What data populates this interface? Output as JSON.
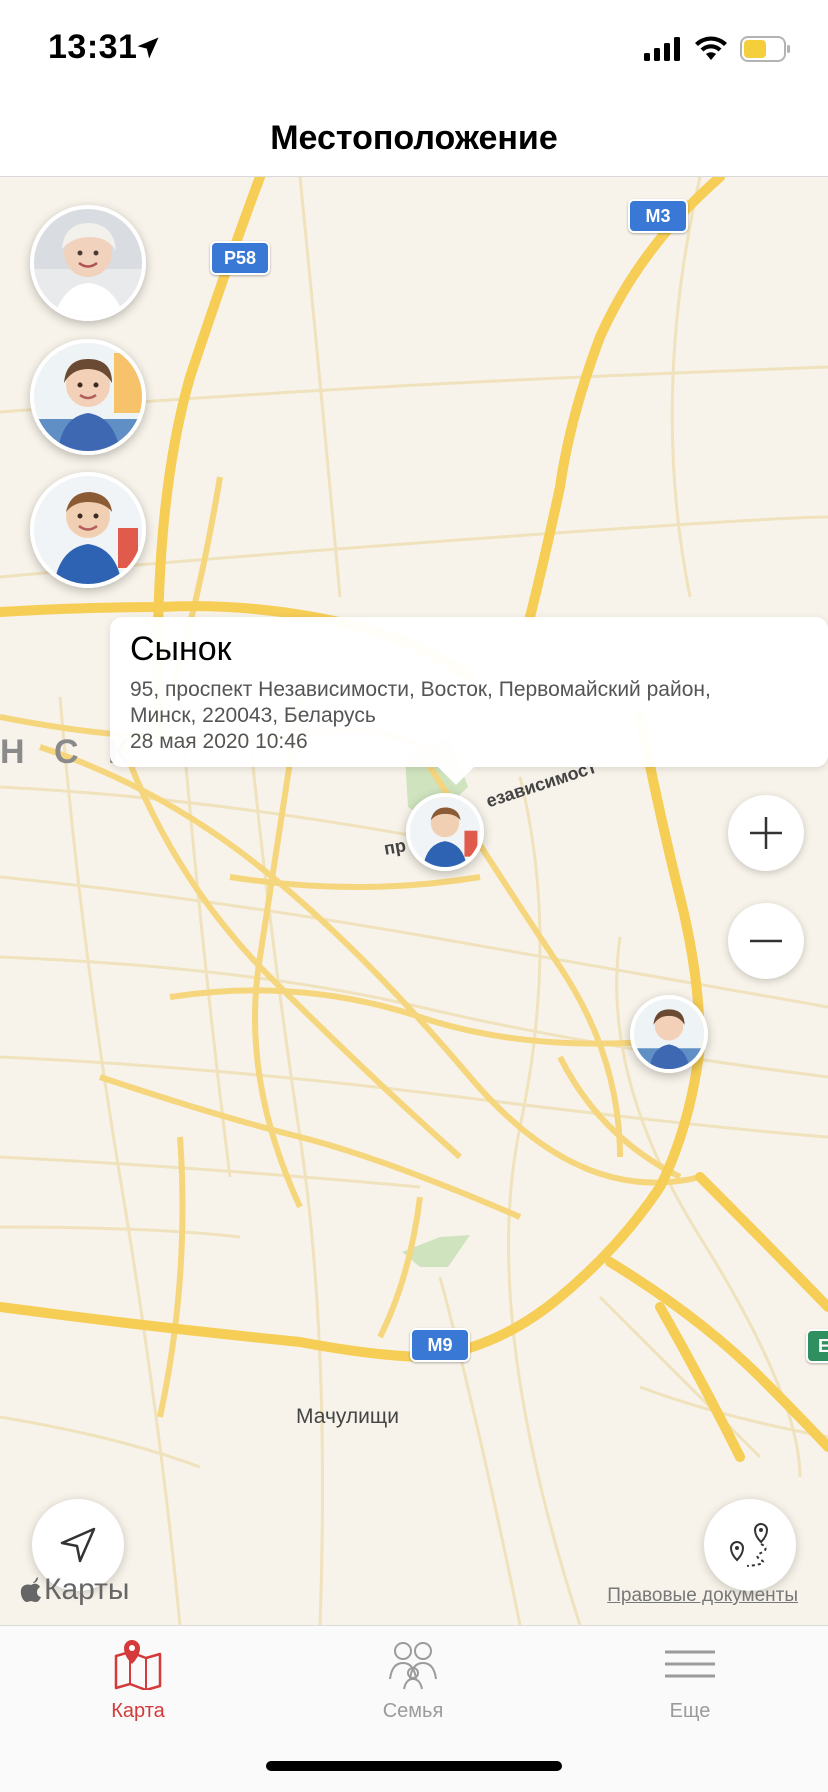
{
  "status_bar": {
    "time": "13:31",
    "icons": [
      "location-arrow-icon",
      "signal-icon",
      "wifi-icon",
      "battery-icon"
    ],
    "battery_color": "#f4cf3b"
  },
  "header": {
    "title": "Местоположение"
  },
  "map": {
    "city_label": "Н С К",
    "district_label": "Мачулищи",
    "street_labels": [
      "езависимост",
      "пр"
    ],
    "road_shields": [
      "P58",
      "M3",
      "M9",
      "E"
    ],
    "callout": {
      "title": "Сынок",
      "address_line1": "95, проспект Независимости, Восток, Первомайский район,",
      "address_line2": "Минск, 220043, Беларусь",
      "timestamp": "28 мая 2020 10:46"
    },
    "zoom_in_label": "+",
    "zoom_out_label": "−",
    "maps_attribution": "Карты",
    "legal_link": "Правовые документы",
    "avatars": [
      "grandmother-avatar",
      "daughter-avatar",
      "son-avatar"
    ],
    "markers": [
      "son-marker",
      "daughter-marker"
    ]
  },
  "tab_bar": {
    "tabs": [
      {
        "label": "Карта",
        "icon": "map-icon",
        "active": true
      },
      {
        "label": "Семья",
        "icon": "family-icon",
        "active": false
      },
      {
        "label": "Еще",
        "icon": "menu-icon",
        "active": false
      }
    ],
    "active_color": "#d43a3a",
    "inactive_color": "#9b9b9b"
  }
}
